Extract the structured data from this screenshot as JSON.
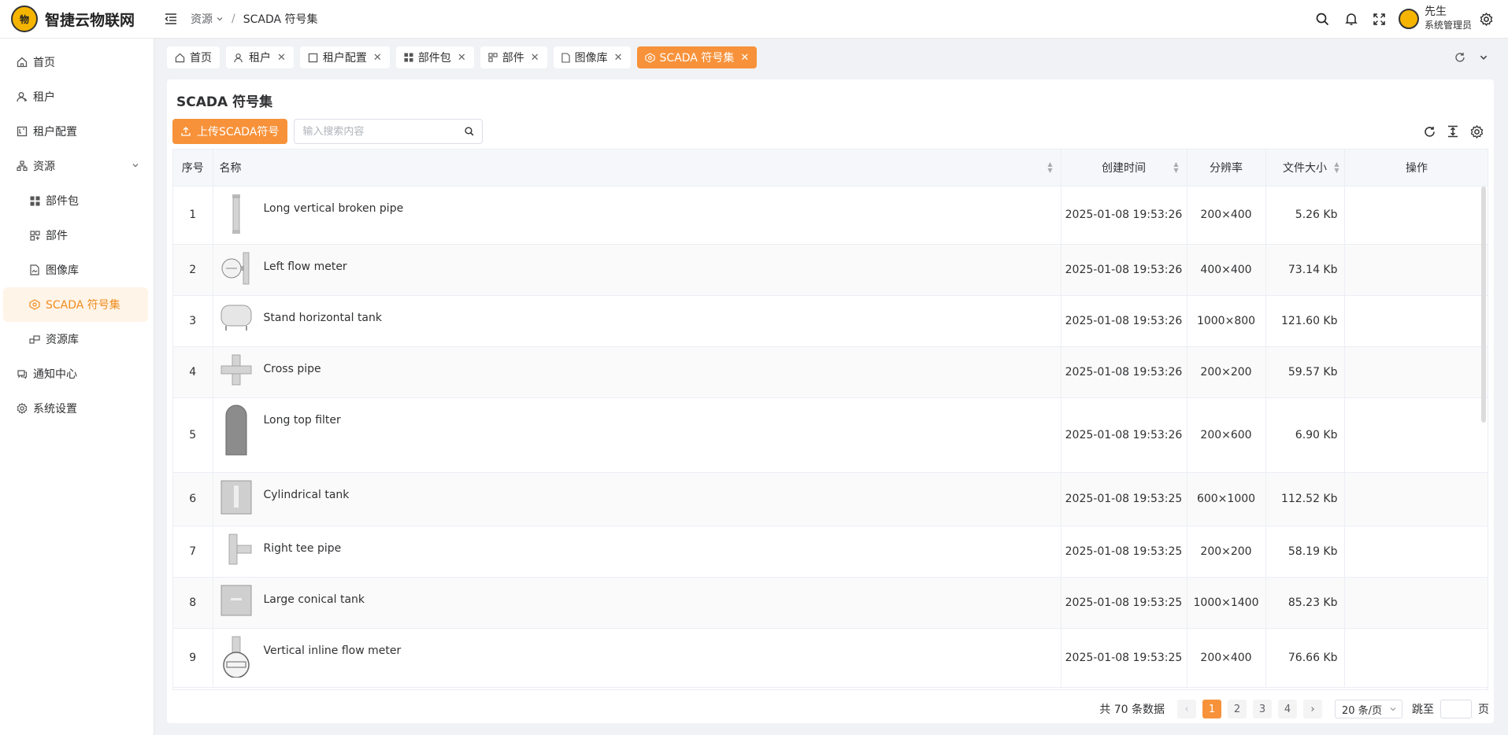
{
  "app": {
    "logo_text": "智捷云物联网",
    "logo_mark": "物"
  },
  "breadcrumb": {
    "parent": "资源",
    "separator": "/",
    "current": "SCADA 符号集"
  },
  "user": {
    "name": "先生",
    "role": "系统管理员"
  },
  "sidebar": {
    "items": [
      {
        "label": "首页",
        "icon": "home-icon"
      },
      {
        "label": "租户",
        "icon": "tenant-icon"
      },
      {
        "label": "租户配置",
        "icon": "tenant-config-icon"
      },
      {
        "label": "资源",
        "icon": "resource-icon"
      },
      {
        "label": "部件包",
        "icon": "grid-icon"
      },
      {
        "label": "部件",
        "icon": "component-icon"
      },
      {
        "label": "图像库",
        "icon": "image-file-icon"
      },
      {
        "label": "SCADA 符号集",
        "icon": "scada-icon"
      },
      {
        "label": "资源库",
        "icon": "library-icon"
      },
      {
        "label": "通知中心",
        "icon": "chat-icon"
      },
      {
        "label": "系统设置",
        "icon": "gear-icon"
      }
    ]
  },
  "tabs": [
    {
      "label": "首页"
    },
    {
      "label": "租户"
    },
    {
      "label": "租户配置"
    },
    {
      "label": "部件包"
    },
    {
      "label": "部件"
    },
    {
      "label": "图像库"
    },
    {
      "label": "SCADA 符号集"
    }
  ],
  "page": {
    "title": "SCADA 符号集",
    "upload_label": "上传SCADA符号",
    "search_placeholder": "输入搜索内容"
  },
  "table": {
    "headers": {
      "index": "序号",
      "name": "名称",
      "created": "创建时间",
      "resolution": "分辨率",
      "size": "文件大小",
      "actions": "操作"
    },
    "rows": [
      {
        "index": "1",
        "name": "Long vertical broken pipe",
        "created": "2025-01-08 19:53:26",
        "resolution": "200×400",
        "size": "5.26 Kb"
      },
      {
        "index": "2",
        "name": "Left flow meter",
        "created": "2025-01-08 19:53:26",
        "resolution": "400×400",
        "size": "73.14 Kb"
      },
      {
        "index": "3",
        "name": "Stand horizontal tank",
        "created": "2025-01-08 19:53:26",
        "resolution": "1000×800",
        "size": "121.60 Kb"
      },
      {
        "index": "4",
        "name": "Cross pipe",
        "created": "2025-01-08 19:53:26",
        "resolution": "200×200",
        "size": "59.57 Kb"
      },
      {
        "index": "5",
        "name": "Long top filter",
        "created": "2025-01-08 19:53:26",
        "resolution": "200×600",
        "size": "6.90 Kb"
      },
      {
        "index": "6",
        "name": "Cylindrical tank",
        "created": "2025-01-08 19:53:25",
        "resolution": "600×1000",
        "size": "112.52 Kb"
      },
      {
        "index": "7",
        "name": "Right tee pipe",
        "created": "2025-01-08 19:53:25",
        "resolution": "200×200",
        "size": "58.19 Kb"
      },
      {
        "index": "8",
        "name": "Large conical tank",
        "created": "2025-01-08 19:53:25",
        "resolution": "1000×1400",
        "size": "85.23 Kb"
      },
      {
        "index": "9",
        "name": "Vertical inline flow meter",
        "created": "2025-01-08 19:53:25",
        "resolution": "200×400",
        "size": "76.66 Kb"
      }
    ]
  },
  "pagination": {
    "total_text": "共 70 条数据",
    "pages": [
      "1",
      "2",
      "3",
      "4"
    ],
    "current_page": "1",
    "page_size": "20 条/页",
    "jump_label": "跳至",
    "page_suffix": "页"
  },
  "colors": {
    "accent": "#f7923a",
    "active_bg": "#fff4e8",
    "active_text": "#f08c1c"
  }
}
